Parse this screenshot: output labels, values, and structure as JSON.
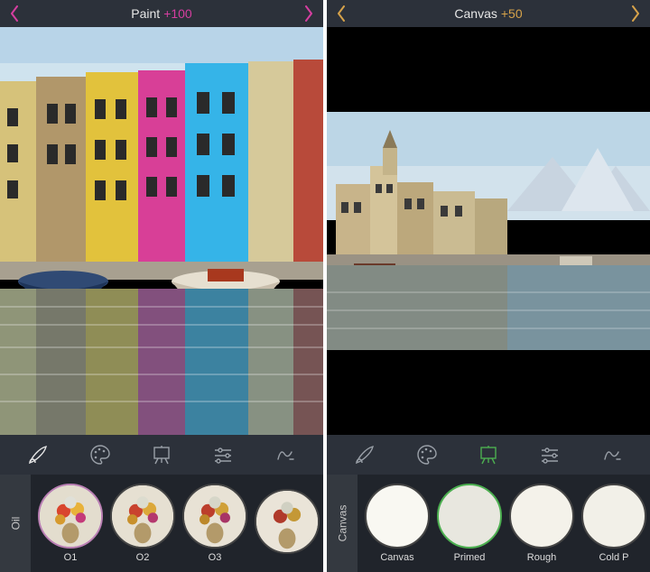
{
  "left": {
    "header": {
      "title": "Paint",
      "suffix": "+100",
      "suffix_color": "#d63ea0",
      "chevron_color": "#d63ea0"
    },
    "toolbar": {
      "brush_selected": true,
      "tool_color_default": "#9aa0a8"
    },
    "strip": {
      "category_label": "Oil",
      "presets": [
        {
          "label": "O1",
          "selected": true
        },
        {
          "label": "O2",
          "selected": false
        },
        {
          "label": "O3",
          "selected": false
        },
        {
          "label": "",
          "selected": false
        }
      ]
    }
  },
  "right": {
    "header": {
      "title": "Canvas",
      "suffix": "+50",
      "suffix_color": "#d6a24a",
      "chevron_color": "#d6a24a"
    },
    "toolbar": {
      "canvas_selected_color": "#4caf50",
      "tool_color_default": "#9aa0a8"
    },
    "strip": {
      "category_label": "Canvas",
      "presets": [
        {
          "label": "Canvas",
          "thumb_class": "thumb-canvas",
          "selected": false
        },
        {
          "label": "Primed",
          "thumb_class": "thumb-primed",
          "selected": true
        },
        {
          "label": "Rough",
          "thumb_class": "thumb-rough",
          "selected": false
        },
        {
          "label": "Cold P",
          "thumb_class": "thumb-coldp",
          "selected": false
        }
      ]
    }
  },
  "icons": {
    "brush": "brush-icon",
    "palette": "palette-icon",
    "easel": "easel-icon",
    "sliders": "sliders-icon",
    "signature": "signature-icon"
  }
}
